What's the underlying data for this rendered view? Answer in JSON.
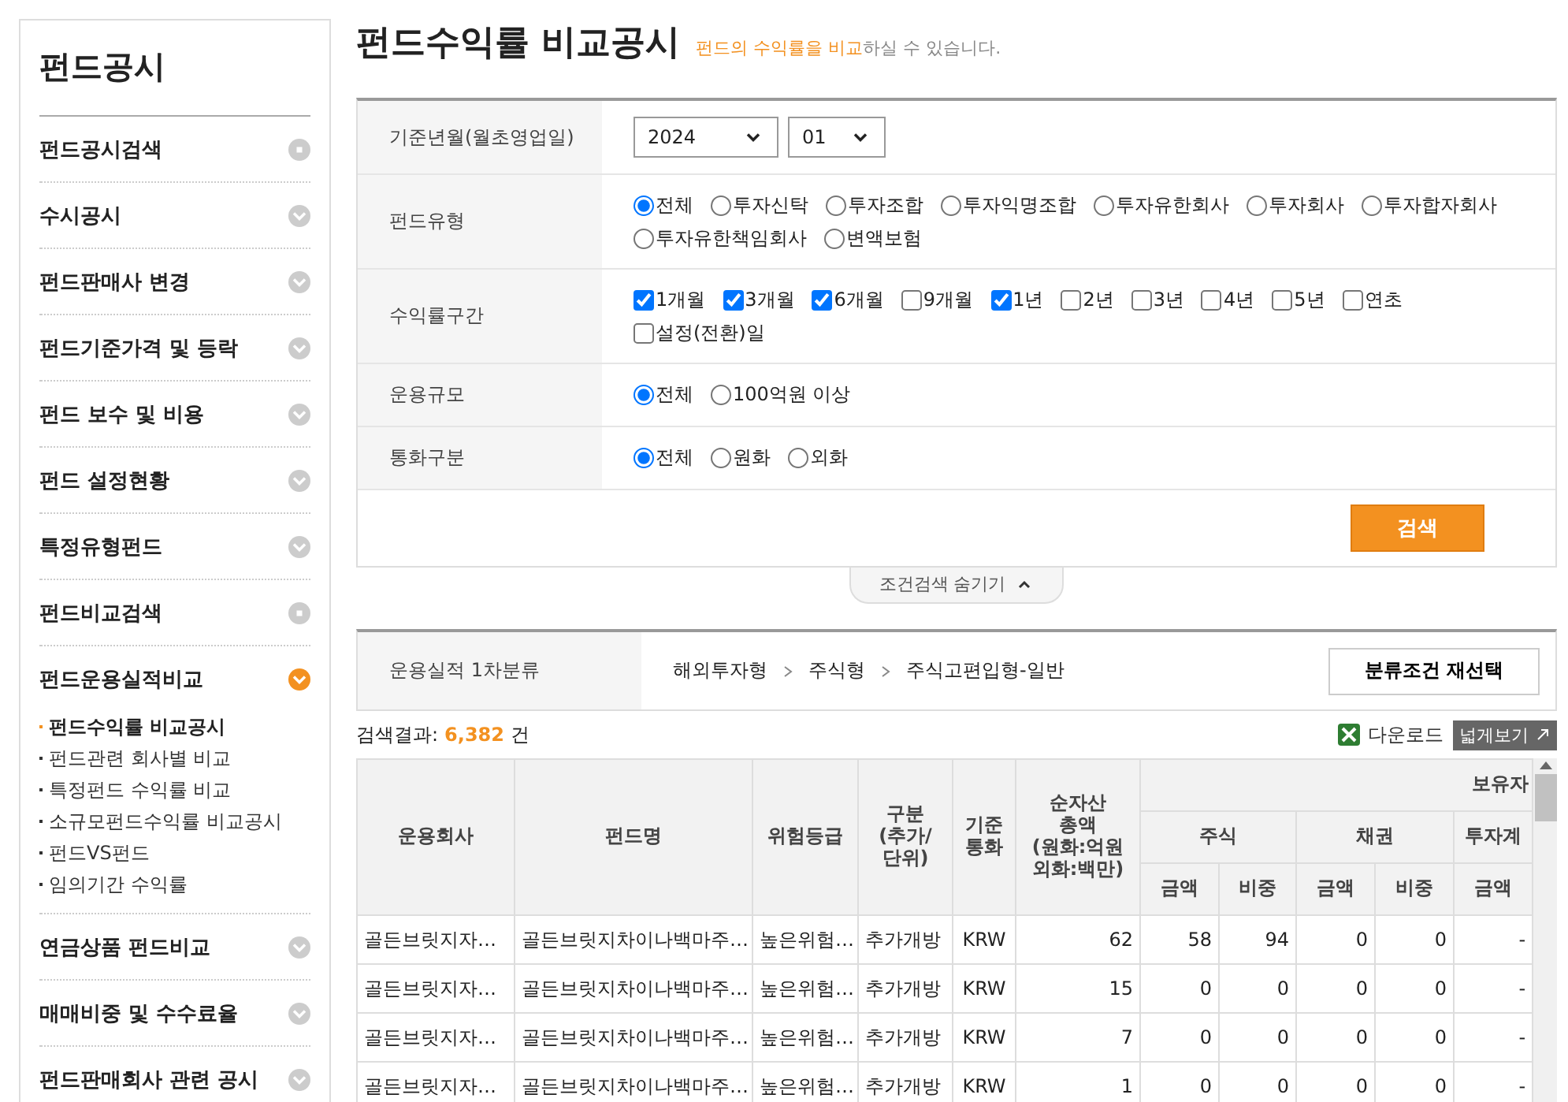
{
  "sidebar": {
    "title": "펀드공시",
    "items": [
      {
        "label": "펀드공시검색",
        "kind": "link"
      },
      {
        "label": "수시공시",
        "kind": "toggle",
        "expanded": false
      },
      {
        "label": "펀드판매사 변경",
        "kind": "toggle",
        "expanded": false
      },
      {
        "label": "펀드기준가격 및 등락",
        "kind": "toggle",
        "expanded": false
      },
      {
        "label": "펀드 보수 및 비용",
        "kind": "toggle",
        "expanded": false
      },
      {
        "label": "펀드 설정현황",
        "kind": "toggle",
        "expanded": false
      },
      {
        "label": "특정유형펀드",
        "kind": "toggle",
        "expanded": false
      },
      {
        "label": "펀드비교검색",
        "kind": "link"
      },
      {
        "label": "펀드운용실적비교",
        "kind": "toggle",
        "expanded": true,
        "children": [
          {
            "label": "펀드수익률 비교공시",
            "selected": true
          },
          {
            "label": "펀드관련 회사별 비교",
            "selected": false
          },
          {
            "label": "특정펀드 수익률 비교",
            "selected": false
          },
          {
            "label": "소규모펀드수익률 비교공시",
            "selected": false
          },
          {
            "label": "펀드VS펀드",
            "selected": false
          },
          {
            "label": "임의기간 수익률",
            "selected": false
          }
        ]
      },
      {
        "label": "연금상품 펀드비교",
        "kind": "toggle",
        "expanded": false
      },
      {
        "label": "매매비중 및 수수료율",
        "kind": "toggle",
        "expanded": false
      },
      {
        "label": "펀드판매회사 관련 공시",
        "kind": "toggle",
        "expanded": false
      }
    ]
  },
  "page": {
    "title": "펀드수익률 비교공시",
    "subtitle": [
      {
        "text": "펀드의 수익률을 비교",
        "highlight": true
      },
      {
        "text": "하실 수 있습니다.",
        "highlight": false
      }
    ]
  },
  "filters": [
    {
      "label": "기준년월(월초영업일)",
      "kind": "selects",
      "selects": [
        {
          "value": "2024"
        },
        {
          "value": "01"
        }
      ]
    },
    {
      "label": "펀드유형",
      "kind": "radios",
      "options": [
        {
          "label": "전체",
          "selected": true
        },
        {
          "label": "투자신탁",
          "selected": false
        },
        {
          "label": "투자조합",
          "selected": false
        },
        {
          "label": "투자익명조합",
          "selected": false
        },
        {
          "label": "투자유한회사",
          "selected": false
        },
        {
          "label": "투자회사",
          "selected": false
        },
        {
          "label": "투자합자회사",
          "selected": false
        },
        {
          "label": "투자유한책임회사",
          "selected": false
        },
        {
          "label": "변액보험",
          "selected": false
        }
      ]
    },
    {
      "label": "수익률구간",
      "kind": "checks",
      "options": [
        {
          "label": "1개월",
          "checked": true
        },
        {
          "label": "3개월",
          "checked": true
        },
        {
          "label": "6개월",
          "checked": true
        },
        {
          "label": "9개월",
          "checked": false
        },
        {
          "label": "1년",
          "checked": true
        },
        {
          "label": "2년",
          "checked": false
        },
        {
          "label": "3년",
          "checked": false
        },
        {
          "label": "4년",
          "checked": false
        },
        {
          "label": "5년",
          "checked": false
        },
        {
          "label": "연초",
          "checked": false
        },
        {
          "label": "설정(전환)일",
          "checked": false
        }
      ]
    },
    {
      "label": "운용규모",
      "kind": "radios",
      "options": [
        {
          "label": "전체",
          "selected": true
        },
        {
          "label": "100억원 이상",
          "selected": false
        }
      ]
    },
    {
      "label": "통화구분",
      "kind": "radios",
      "options": [
        {
          "label": "전체",
          "selected": true
        },
        {
          "label": "원화",
          "selected": false
        },
        {
          "label": "외화",
          "selected": false
        }
      ]
    }
  ],
  "search_button": "검색",
  "toggle_filters": "조건검색 숨기기",
  "classification": {
    "label": "운용실적 1차분류",
    "path": [
      "해외투자형",
      "주식형",
      "주식고편입형-일반"
    ],
    "button": "분류조건 재선택"
  },
  "results": {
    "label": "검색결과:",
    "count": "6,382",
    "unit": "건",
    "download": "다운로드",
    "wide_view": "넓게보기"
  },
  "table": {
    "columns": [
      {
        "label": "운용회사"
      },
      {
        "label": "펀드명"
      },
      {
        "label": "위험등급"
      },
      {
        "label": "구분\n(추가/\n단위)"
      },
      {
        "label": "기준\n통화"
      },
      {
        "label": "순자산\n총액\n(원화:억원\n외화:백만)"
      },
      {
        "label": "보유자",
        "colspan": 5,
        "children": [
          {
            "label": "주식",
            "colspan": 2,
            "children": [
              {
                "label": "금액"
              },
              {
                "label": "비중"
              }
            ]
          },
          {
            "label": "채권",
            "colspan": 2,
            "children": [
              {
                "label": "금액"
              },
              {
                "label": "비중"
              }
            ]
          },
          {
            "label": "투자계",
            "children": [
              {
                "label": "금액"
              }
            ]
          }
        ]
      }
    ],
    "rows": [
      [
        "골든브릿지자…",
        "골든브릿지차이나백마주…",
        "높은위험…",
        "추가개방",
        "KRW",
        "62",
        "58",
        "94",
        "0",
        "0",
        "-"
      ],
      [
        "골든브릿지자…",
        "골든브릿지차이나백마주…",
        "높은위험…",
        "추가개방",
        "KRW",
        "15",
        "0",
        "0",
        "0",
        "0",
        "-"
      ],
      [
        "골든브릿지자…",
        "골든브릿지차이나백마주…",
        "높은위험…",
        "추가개방",
        "KRW",
        "7",
        "0",
        "0",
        "0",
        "0",
        "-"
      ],
      [
        "골든브릿지자…",
        "골든브릿지차이나백마주…",
        "높은위험…",
        "추가개방",
        "KRW",
        "1",
        "0",
        "0",
        "0",
        "0",
        "-"
      ]
    ]
  }
}
